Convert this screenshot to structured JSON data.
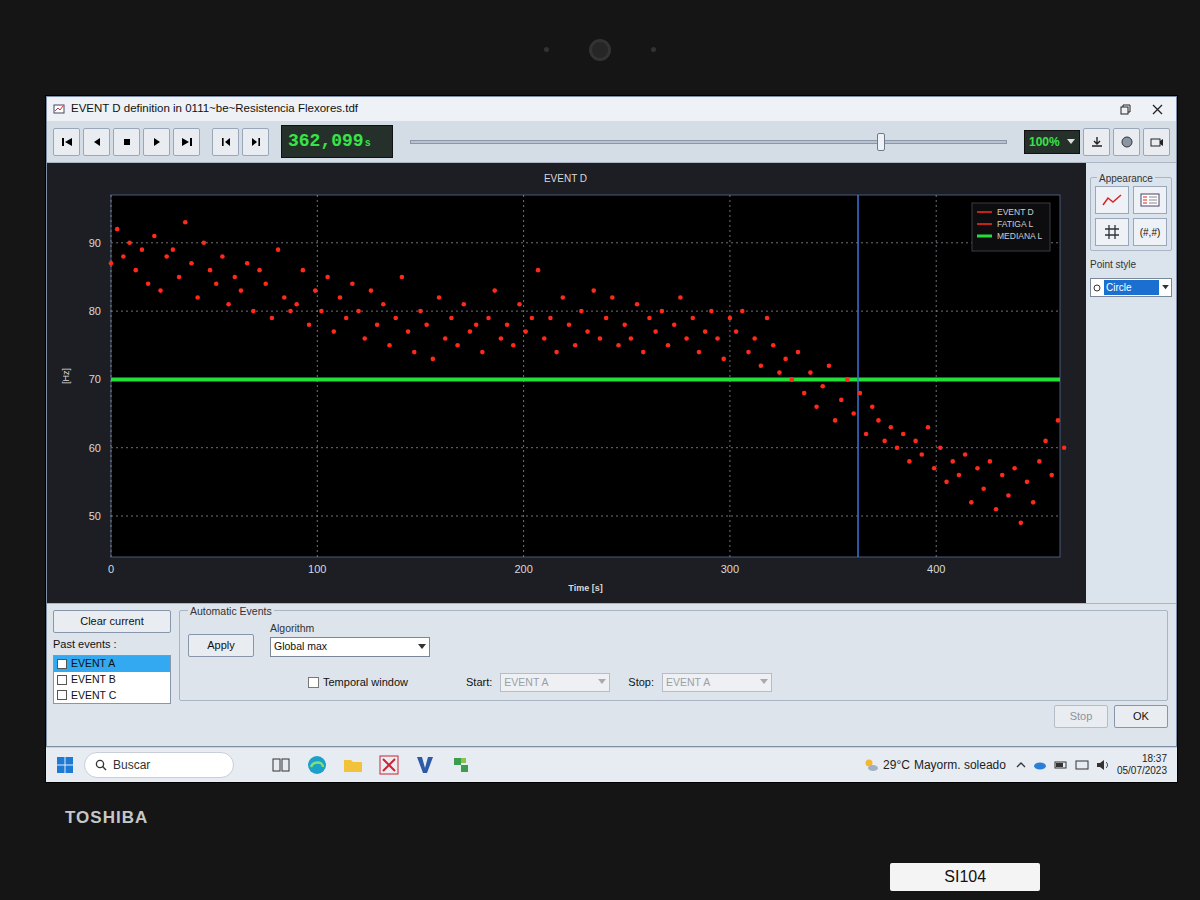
{
  "window": {
    "title": "EVENT D definition in 0111~be~Resistencia Flexores.tdf"
  },
  "toolbar": {
    "time_display": {
      "value": "362,099",
      "unit": "s"
    },
    "timeline": {
      "level": 0.79
    },
    "zoom": "100%"
  },
  "chart": {
    "title": "EVENT D",
    "y_label": "[Hz]",
    "x_label": "Time [s]",
    "y_ticks": [
      "50",
      "60",
      "70",
      "80",
      "90"
    ],
    "x_ticks": [
      "0",
      "100",
      "200",
      "300",
      "400"
    ],
    "legend": [
      {
        "label": "EVENT D",
        "color": "#ff2a1a"
      },
      {
        "label": "FATIGA L",
        "color": "#ff2a1a"
      },
      {
        "label": "MEDIANA L",
        "color": "#22e03a"
      }
    ],
    "series": [
      {
        "name": "FATIGA L",
        "color": "#ff2a1a",
        "start_s": 0,
        "step_s": 3,
        "values": [
          87,
          92,
          88,
          90,
          86,
          89,
          84,
          91,
          83,
          88,
          89,
          85,
          93,
          87,
          82,
          90,
          86,
          84,
          88,
          81,
          85,
          83,
          87,
          80,
          86,
          84,
          79,
          89,
          82,
          80,
          81,
          86,
          78,
          83,
          80,
          85,
          77,
          82,
          79,
          84,
          80,
          76,
          83,
          78,
          81,
          75,
          79,
          85,
          77,
          74,
          80,
          78,
          73,
          82,
          76,
          79,
          75,
          81,
          77,
          78,
          74,
          79,
          83,
          76,
          78,
          75,
          81,
          77,
          79,
          86,
          76,
          79,
          74,
          82,
          78,
          75,
          80,
          77,
          83,
          76,
          79,
          82,
          75,
          78,
          76,
          81,
          74,
          79,
          77,
          80,
          75,
          78,
          82,
          76,
          79,
          74,
          77,
          80,
          76,
          73,
          79,
          77,
          80,
          74,
          76,
          72,
          79,
          75,
          71,
          73,
          70,
          74,
          68,
          71,
          66,
          69,
          72,
          64,
          67,
          70,
          65,
          68,
          62,
          66,
          64,
          61,
          63,
          60,
          62,
          58,
          61,
          59,
          63,
          57,
          60,
          55,
          58,
          56,
          59,
          52,
          57,
          54,
          58,
          51,
          56,
          53,
          57,
          49,
          55,
          52,
          58,
          61,
          56,
          64,
          60
        ]
      }
    ],
    "median": {
      "name": "MEDIANA L",
      "value": 70,
      "color": "#22e03a"
    },
    "cursor_s": 362.099
  },
  "appearance": {
    "title": "Appearance",
    "grid_label": "(#,#)",
    "point_style": {
      "label": "Point style",
      "value": "Circle"
    }
  },
  "events": {
    "clear": "Clear current",
    "past_label": "Past events :",
    "items": [
      {
        "label": "EVENT A",
        "selected": true,
        "checked": false
      },
      {
        "label": "EVENT B",
        "selected": false,
        "checked": false
      },
      {
        "label": "EVENT C",
        "selected": false,
        "checked": false
      }
    ]
  },
  "automatic": {
    "title": "Automatic Events",
    "apply": "Apply",
    "algorithm_label": "Algorithm",
    "algorithm": "Global max",
    "temporal_window": {
      "label": "Temporal window",
      "checked": false
    },
    "start": {
      "label": "Start:",
      "value": "EVENT A",
      "disabled": true
    },
    "stop": {
      "label": "Stop:",
      "value": "EVENT A",
      "disabled": true
    }
  },
  "buttons": [
    {
      "label": "Stop",
      "disabled": true
    },
    {
      "label": "OK",
      "disabled": false
    }
  ],
  "taskbar": {
    "search": "Buscar",
    "weather": {
      "temp": "29°C",
      "text": "Mayorm. soleado"
    },
    "time": "18:37",
    "date": "05/07/2023"
  },
  "bezel": {
    "brand": "TOSHIBA",
    "sticker": "SI104"
  }
}
